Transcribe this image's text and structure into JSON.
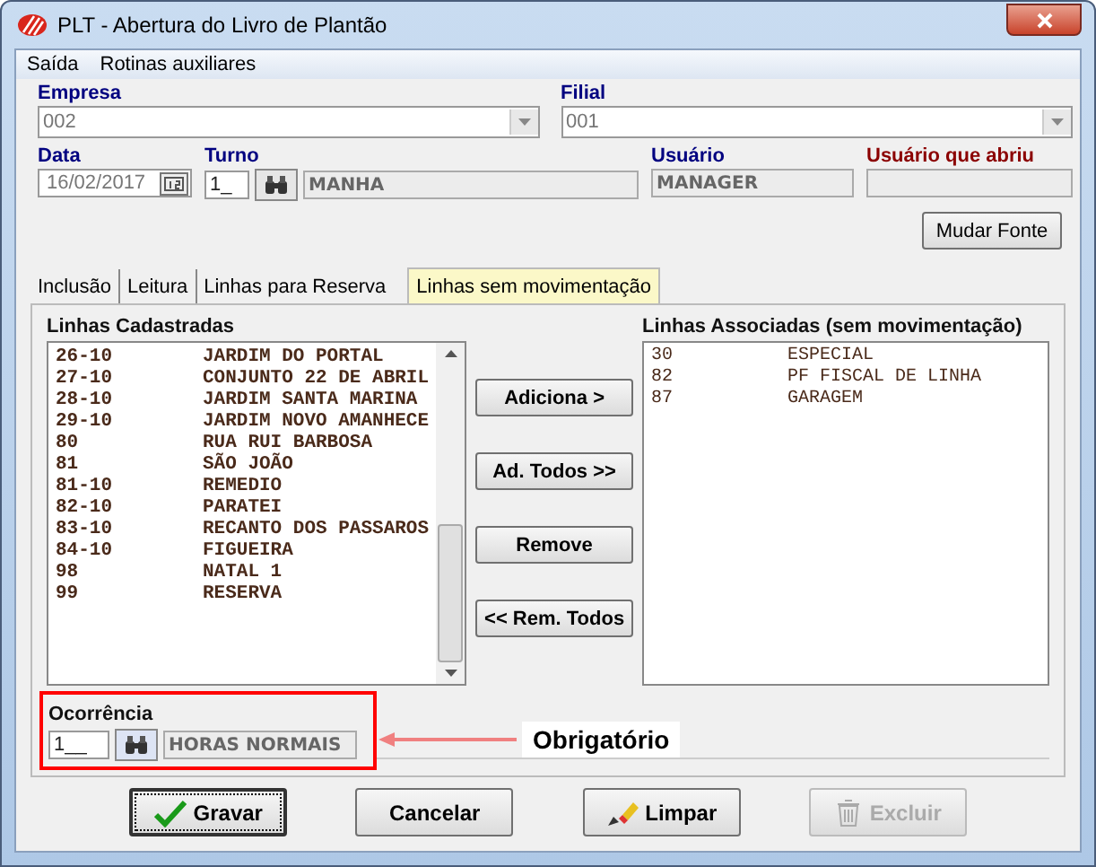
{
  "window": {
    "title": "PLT - Abertura do Livro de Plantão"
  },
  "menu": [
    {
      "label": "Saída"
    },
    {
      "label": "Rotinas auxiliares"
    }
  ],
  "empresa": {
    "label": "Empresa",
    "value": "002"
  },
  "filial": {
    "label": "Filial",
    "value": "001"
  },
  "data": {
    "label": "Data",
    "value": "16/02/2017"
  },
  "turno": {
    "label": "Turno",
    "value": "1_",
    "description": "MANHA"
  },
  "usuario": {
    "label": "Usuário",
    "value": "MANAGER"
  },
  "usuario_abriu": {
    "label": "Usuário que abriu"
  },
  "font_button": {
    "label": "Mudar Fonte"
  },
  "tabs": [
    {
      "label": "Inclusão",
      "selected": false
    },
    {
      "label": "Leitura",
      "selected": false
    },
    {
      "label": "Linhas para Reserva",
      "selected": false
    },
    {
      "label": "Linhas sem movimentação",
      "selected": true
    }
  ],
  "lista_cadastradas": {
    "title": "Linhas Cadastradas",
    "items": [
      {
        "code": "26-10",
        "name": "JARDIM DO PORTAL"
      },
      {
        "code": "27-10",
        "name": "CONJUNTO 22 DE ABRIL"
      },
      {
        "code": "28-10",
        "name": "JARDIM SANTA MARINA"
      },
      {
        "code": "29-10",
        "name": "JARDIM NOVO AMANHECE"
      },
      {
        "code": "80",
        "name": "RUA RUI BARBOSA"
      },
      {
        "code": "81",
        "name": "SÃO JOÃO"
      },
      {
        "code": "81-10",
        "name": "REMEDIO"
      },
      {
        "code": "82-10",
        "name": "PARATEI"
      },
      {
        "code": "83-10",
        "name": "RECANTO DOS PASSAROS"
      },
      {
        "code": "84-10",
        "name": "FIGUEIRA"
      },
      {
        "code": "98",
        "name": "NATAL 1"
      },
      {
        "code": "99",
        "name": "RESERVA"
      }
    ]
  },
  "move_buttons": [
    {
      "label": "Adiciona >"
    },
    {
      "label": "Ad. Todos >>"
    },
    {
      "label": "Remove"
    },
    {
      "label": "<< Rem. Todos"
    }
  ],
  "lista_associadas": {
    "title": "Linhas Associadas (sem movimentação)",
    "items": [
      {
        "code": "30",
        "name": "ESPECIAL"
      },
      {
        "code": "82",
        "name": "PF FISCAL DE LINHA"
      },
      {
        "code": "87",
        "name": "GARAGEM"
      }
    ]
  },
  "ocorrencia": {
    "label": "Ocorrência",
    "value": "1__",
    "description": "HORAS NORMAIS"
  },
  "annotation": {
    "text": "Obrigatório"
  },
  "actions": [
    {
      "label": "Gravar",
      "kind": "check",
      "disabled": false
    },
    {
      "label": "Cancelar",
      "kind": "plain",
      "disabled": false
    },
    {
      "label": "Limpar",
      "kind": "eraser",
      "disabled": false
    },
    {
      "label": "Excluir",
      "kind": "trash",
      "disabled": true
    }
  ]
}
